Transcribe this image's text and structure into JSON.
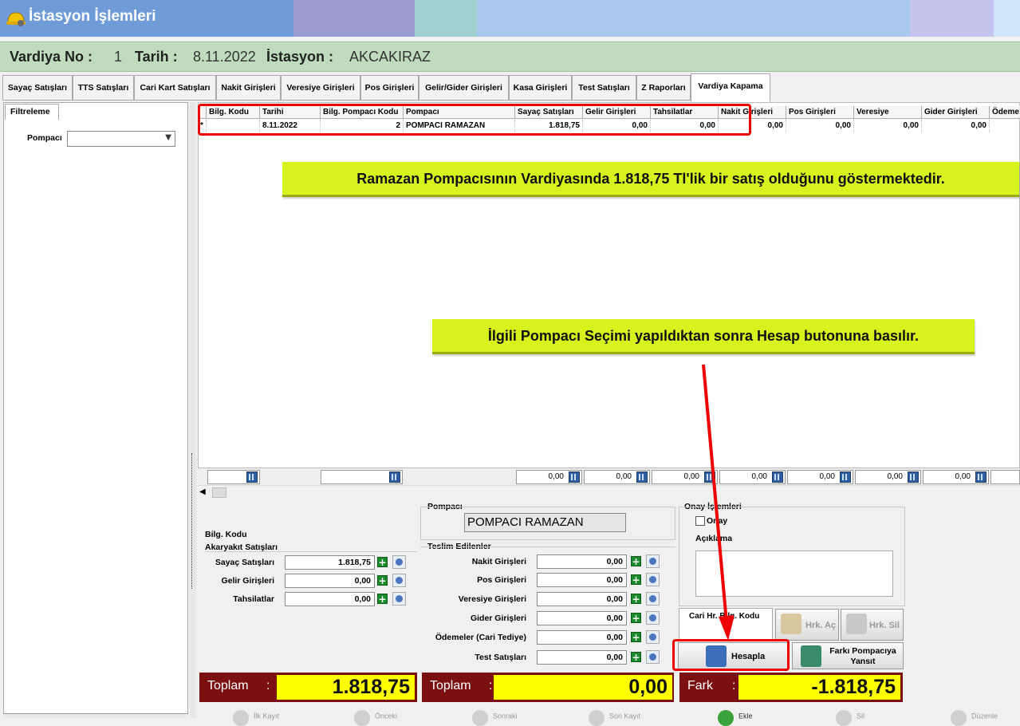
{
  "window": {
    "title": "İstasyon İşlemleri",
    "icon": "hard-hat-icon"
  },
  "header": {
    "vardiya_label": "Vardiya No :",
    "vardiya_value": "1",
    "tarih_label": "Tarih :",
    "tarih_value": "8.11.2022",
    "istasyon_label": "İstasyon :",
    "istasyon_value": "AKCAKIRAZ"
  },
  "tabs": [
    {
      "label": "Sayaç Satışları"
    },
    {
      "label": "TTS Satışları"
    },
    {
      "label": "Cari Kart Satışları"
    },
    {
      "label": "Nakit Girişleri"
    },
    {
      "label": "Veresiye Girişleri"
    },
    {
      "label": "Pos Girişleri"
    },
    {
      "label": "Gelir/Gider Girişleri"
    },
    {
      "label": "Kasa Girişleri"
    },
    {
      "label": "Test Satışları"
    },
    {
      "label": "Z Raporları"
    },
    {
      "label": "Vardiya Kapama",
      "active": true
    }
  ],
  "filter": {
    "tab_label": "Filtreleme",
    "pompaci_label": "Pompacı",
    "pompaci_value": ""
  },
  "grid": {
    "columns": [
      "Bilg. Kodu",
      "Tarihi",
      "Bilg. Pompacı Kodu",
      "Pompacı",
      "Sayaç Satışları",
      "Gelir Girişleri",
      "Tahsilatlar",
      "Nakit Girişleri",
      "Pos Girişleri",
      "Veresiye",
      "Gider Girişleri",
      "Ödeme"
    ],
    "row": {
      "marker": "*",
      "bilg_kodu": "",
      "tarihi": "8.11.2022",
      "bilg_pompaci_kodu": "2",
      "pompaci": "POMPACI RAMAZAN",
      "sayac": "1.818,75",
      "gelir": "0,00",
      "tahsilat": "0,00",
      "nakit": "0,00",
      "pos": "0,00",
      "veresiye": "0,00",
      "gider": "0,00",
      "odeme": ""
    },
    "footer_totals": [
      "0,00",
      "0,00",
      "0,00",
      "0,00",
      "0,00",
      "0,00",
      "0,00"
    ]
  },
  "annotations": {
    "note1": "Ramazan Pompacısının Vardiyasında 1.818,75 Tl'lik bir satış olduğunu göstermektedir.",
    "note2": "İlgili Pompacı Seçimi yapıldıktan sonra Hesap butonuna basılır."
  },
  "left_summary": {
    "bilg_kodu_label": "Bilg. Kodu",
    "akaryakit_label": "Akaryakıt Satışları",
    "rows": [
      {
        "label": "Sayaç Satışları",
        "value": "1.818,75"
      },
      {
        "label": "Gelir Girişleri",
        "value": "0,00"
      },
      {
        "label": "Tahsilatlar",
        "value": "0,00"
      }
    ],
    "total_label": "Toplam",
    "total_value": "1.818,75"
  },
  "middle_summary": {
    "pompaci_group": "Pompacı",
    "pompaci_name": "POMPACI RAMAZAN",
    "teslim_label": "Teslim Edilenler",
    "rows": [
      {
        "label": "Nakit Girişleri",
        "value": "0,00"
      },
      {
        "label": "Pos Girişleri",
        "value": "0,00"
      },
      {
        "label": "Veresiye Girişleri",
        "value": "0,00"
      },
      {
        "label": "Gider Girişleri",
        "value": "0,00"
      },
      {
        "label": "Ödemeler (Cari Tediye)",
        "value": "0,00"
      },
      {
        "label": "Test Satışları",
        "value": "0,00"
      }
    ],
    "total_label": "Toplam",
    "total_value": "0,00"
  },
  "right_summary": {
    "onay_group": "Onay İşlemleri",
    "onay_label": "Onay",
    "aciklama_label": "Açıklama",
    "cari_tab": "Cari Hr. Bilg. Kodu",
    "hrk_ac": "Hrk. Aç",
    "hrk_sil": "Hrk. Sil",
    "hesapla": "Hesapla",
    "farki_line1": "Farkı Pompacıya",
    "farki_line2": "Yansıt",
    "fark_label": "Fark",
    "fark_value": "-1.818,75"
  },
  "bottom_nav": [
    "İlk Kayıt",
    "Önceki",
    "Sonraki",
    "Son Kayıt",
    "Ekle",
    "Sil",
    "Düzenle"
  ],
  "colors": {
    "title_bar": "#6f9bd6",
    "info_bar": "#bfdcbf",
    "annotation": "#d7f21c",
    "highlight_red": "#e00000",
    "total_label_bg": "#7a1010",
    "total_value_bg": "#ffff00"
  }
}
